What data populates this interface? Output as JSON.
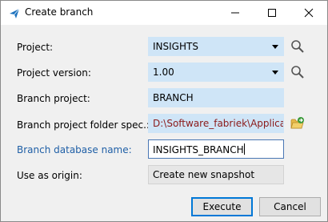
{
  "window": {
    "title": "Create branch"
  },
  "fields": {
    "project": {
      "label": "Project:",
      "value": "INSIGHTS"
    },
    "project_version": {
      "label": "Project version:",
      "value": "1.00"
    },
    "branch_project": {
      "label": "Branch project:",
      "value": "BRANCH"
    },
    "branch_folder": {
      "label": "Branch project folder spec.:",
      "value": "D:\\Software_fabriek\\Applicaties"
    },
    "branch_db": {
      "label": "Branch database name:",
      "value": "INSIGHTS_BRANCH"
    },
    "origin": {
      "label": "Use as origin:",
      "value": "Create new snapshot"
    }
  },
  "buttons": {
    "execute": "Execute",
    "cancel": "Cancel"
  },
  "icons": {
    "app": "send-arrow-icon",
    "search": "search-icon",
    "folder": "folder-open-icon"
  },
  "colors": {
    "input_blue": "#cfe5f7",
    "link_label": "#1f5fa6",
    "path_text": "#8b1a1a",
    "focus_border": "#0078d7"
  }
}
